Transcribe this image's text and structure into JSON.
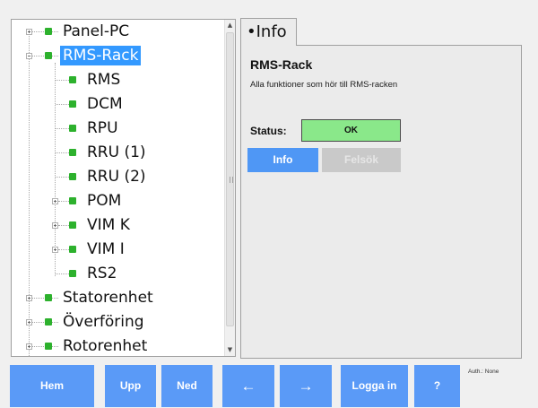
{
  "tree": {
    "nodes": [
      {
        "label": "Panel-PC",
        "level": 0,
        "expander": "plus",
        "selected": false
      },
      {
        "label": "RMS-Rack",
        "level": 0,
        "expander": "minus",
        "selected": true
      },
      {
        "label": "RMS",
        "level": 1,
        "expander": null,
        "selected": false
      },
      {
        "label": "DCM",
        "level": 1,
        "expander": null,
        "selected": false
      },
      {
        "label": "RPU",
        "level": 1,
        "expander": null,
        "selected": false
      },
      {
        "label": "RRU (1)",
        "level": 1,
        "expander": null,
        "selected": false
      },
      {
        "label": "RRU (2)",
        "level": 1,
        "expander": null,
        "selected": false
      },
      {
        "label": "POM",
        "level": 1,
        "expander": "plus",
        "selected": false
      },
      {
        "label": "VIM K",
        "level": 1,
        "expander": "plus",
        "selected": false
      },
      {
        "label": "VIM I",
        "level": 1,
        "expander": "plus",
        "selected": false
      },
      {
        "label": "RS2",
        "level": 1,
        "expander": null,
        "selected": false
      },
      {
        "label": "Statorenhet",
        "level": 0,
        "expander": "plus",
        "selected": false
      },
      {
        "label": "Överföring",
        "level": 0,
        "expander": "plus",
        "selected": false
      },
      {
        "label": "Rotorenhet",
        "level": 0,
        "expander": "plus",
        "selected": false
      }
    ],
    "icon_color": "#2db12d",
    "selection_color": "#3399ff"
  },
  "info_tab": {
    "tab_label": "•Info",
    "title": "RMS-Rack",
    "description": "Alla funktioner som hör till RMS-racken",
    "status_label": "Status:",
    "status_value": "OK",
    "status_color": "#8ae88a",
    "info_button": "Info",
    "felsok_button": "Felsök"
  },
  "bottom_bar": {
    "buttons": [
      "Hem",
      "Upp",
      "Ned",
      "←",
      "→",
      "Logga in",
      "?"
    ],
    "auth_text": "Auth.: None",
    "button_color": "#5a9af7"
  }
}
